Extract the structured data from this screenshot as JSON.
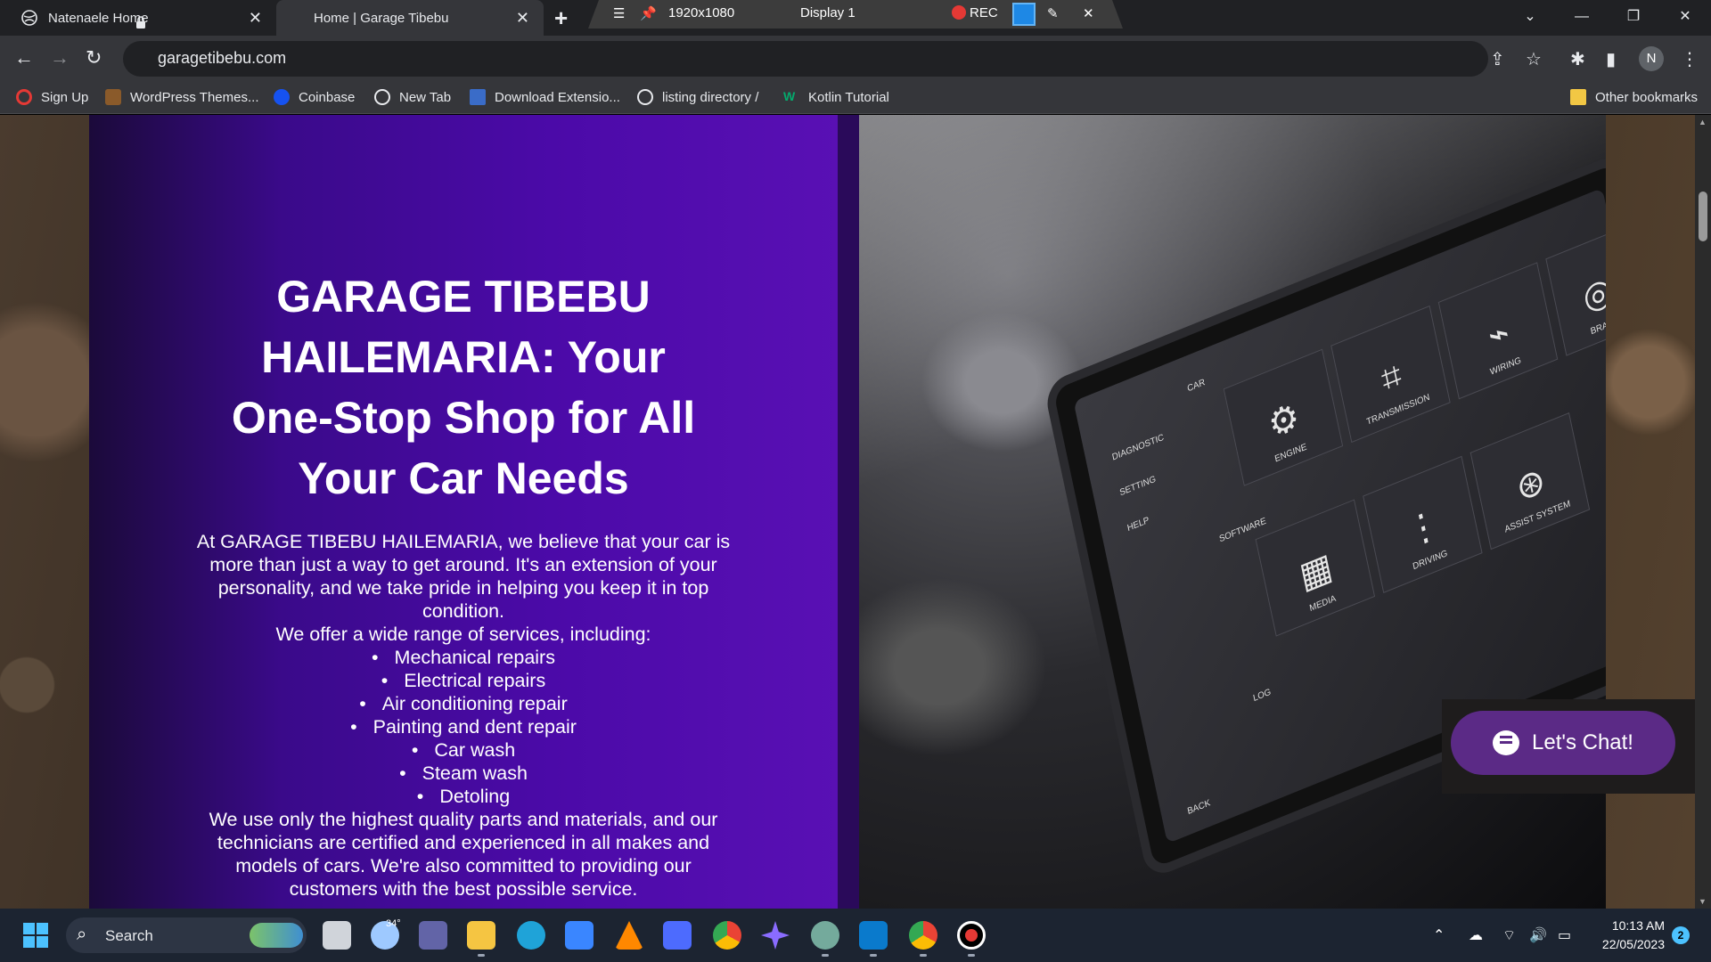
{
  "browser": {
    "tabs": [
      {
        "label": "Natenaele Home",
        "active": false
      },
      {
        "label": "Home | Garage Tibebu",
        "active": true
      }
    ],
    "recorder": {
      "resolution": "1920x1080",
      "display": "Display 1",
      "rec_label": "REC"
    },
    "address": {
      "url": "garagetibebu.com"
    },
    "profile_initial": "N",
    "bookmarks": [
      {
        "label": "Sign Up",
        "icon": "opera-icon"
      },
      {
        "label": "WordPress Themes...",
        "icon": "wordpress-icon"
      },
      {
        "label": "Coinbase",
        "icon": "coinbase-icon"
      },
      {
        "label": "New Tab",
        "icon": "globe-icon"
      },
      {
        "label": "Download Extensio...",
        "icon": "extension-icon"
      },
      {
        "label": "listing directory /",
        "icon": "globe-icon"
      },
      {
        "label": "Kotlin Tutorial",
        "icon": "w3-icon"
      }
    ],
    "other_bookmarks": "Other bookmarks"
  },
  "hero": {
    "title": "GARAGE TIBEBU HAILEMARIA: Your One-Stop Shop for All Your Car Needs",
    "intro": "At GARAGE TIBEBU HAILEMARIA, we believe that your car is more than just a way to get around. It's an extension of your personality, and we take pride in helping you keep it in top condition.",
    "services_intro": "We offer a wide range of services, including:",
    "services": [
      "Mechanical repairs",
      "Electrical repairs",
      "Air conditioning repair",
      "Painting and dent repair",
      "Car wash",
      "Steam wash",
      "Detoling"
    ],
    "closing": "We use only the highest quality parts and materials, and our technicians are certified and experienced in all makes and models of cars. We're also committed to providing our customers with the best possible service."
  },
  "tablet_screen": {
    "menu": [
      "DIAGNOSTIC",
      "SETTING",
      "HELP"
    ],
    "sections": [
      "CAR",
      "SOFTWARE",
      "LOG"
    ],
    "tiles": [
      "ENGINE",
      "TRANSMISSION",
      "WIRING",
      "BRAKE",
      "MEDIA",
      "DRIVING",
      "ASSIST SYSTEM"
    ],
    "back": "BACK"
  },
  "chat": {
    "label": "Let's Chat!"
  },
  "taskbar": {
    "search_label": "Search",
    "weather_temp": "34°",
    "time": "10:13 AM",
    "date": "22/05/2023",
    "notifications": "2",
    "apps": [
      {
        "name": "task-view",
        "color": "#d0d4da"
      },
      {
        "name": "weather",
        "color": "#9ec9ff"
      },
      {
        "name": "teams",
        "color": "#6264a7"
      },
      {
        "name": "file-explorer",
        "color": "#f5c542"
      },
      {
        "name": "edge",
        "color": "#1fa3d8"
      },
      {
        "name": "store",
        "color": "#3a86ff"
      },
      {
        "name": "vlc",
        "color": "#ff8800"
      },
      {
        "name": "power-automate",
        "color": "#4d6bfe"
      },
      {
        "name": "chrome",
        "color": "#ea4335"
      },
      {
        "name": "copilot",
        "color": "#8a6cff"
      },
      {
        "name": "chatgpt",
        "color": "#74aa9c"
      },
      {
        "name": "vscode",
        "color": "#0a7acc"
      },
      {
        "name": "chrome-profile",
        "color": "#ea4335"
      },
      {
        "name": "recorder",
        "color": "#e53935"
      }
    ]
  }
}
